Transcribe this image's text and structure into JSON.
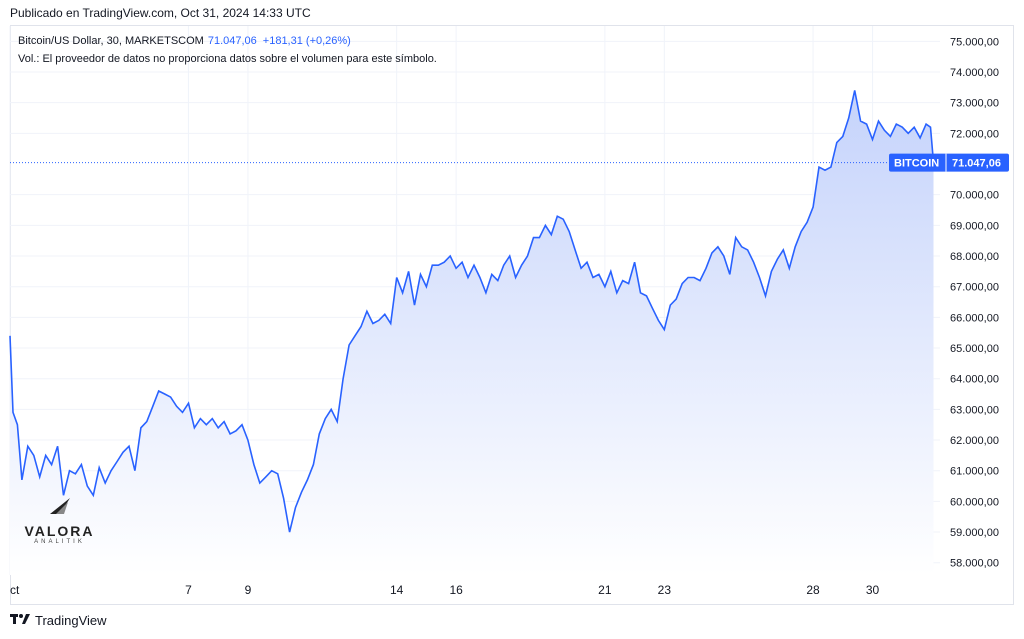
{
  "header": {
    "publish_line": "Publicado en TradingView.com, Oct 31, 2024 14:33 UTC"
  },
  "legend": {
    "symbol": "Bitcoin/US Dollar, 30, MARKETSCOM",
    "last_value": "71.047,06",
    "change": "+181,31 (+0,26%)",
    "volume_note": "Vol.: El proveedor de datos no proporciona datos sobre el volumen para este símbolo."
  },
  "price_tag": {
    "label": "BITCOIN",
    "value": "71.047,06"
  },
  "watermark": {
    "brand": "VALORA",
    "sub": "ANALITIK"
  },
  "footer": {
    "brand": "TradingView"
  },
  "colors": {
    "line": "#2962ff",
    "fill_top": "#c5d3fb",
    "fill_bottom": "#ffffff",
    "grid": "#f0f3fa",
    "tag_bg": "#2962ff"
  },
  "chart_data": {
    "type": "area",
    "title": "Bitcoin/US Dollar, 30, MARKETSCOM",
    "ylim": [
      57600,
      75500
    ],
    "y_ticks": [
      {
        "value": 58000,
        "label": "58.000,00"
      },
      {
        "value": 59000,
        "label": "59.000,00"
      },
      {
        "value": 60000,
        "label": "60.000,00"
      },
      {
        "value": 61000,
        "label": "61.000,00"
      },
      {
        "value": 62000,
        "label": "62.000,00"
      },
      {
        "value": 63000,
        "label": "63.000,00"
      },
      {
        "value": 64000,
        "label": "64.000,00"
      },
      {
        "value": 65000,
        "label": "65.000,00"
      },
      {
        "value": 66000,
        "label": "66.000,00"
      },
      {
        "value": 67000,
        "label": "67.000,00"
      },
      {
        "value": 68000,
        "label": "68.000,00"
      },
      {
        "value": 69000,
        "label": "69.000,00"
      },
      {
        "value": 70000,
        "label": "70.000,00"
      },
      {
        "value": 72000,
        "label": "72.000,00"
      },
      {
        "value": 73000,
        "label": "73.000,00"
      },
      {
        "value": 74000,
        "label": "74.000,00"
      },
      {
        "value": 75000,
        "label": "75.000,00"
      }
    ],
    "xlim": [
      1,
      32.1
    ],
    "x_ticks": [
      {
        "value": 1,
        "label": "ct"
      },
      {
        "value": 7,
        "label": "7"
      },
      {
        "value": 9,
        "label": "9"
      },
      {
        "value": 14,
        "label": "14"
      },
      {
        "value": 16,
        "label": "16"
      },
      {
        "value": 21,
        "label": "21"
      },
      {
        "value": 23,
        "label": "23"
      },
      {
        "value": 28,
        "label": "28"
      },
      {
        "value": 30,
        "label": "30"
      }
    ],
    "last_price": 71047.06,
    "series": [
      {
        "x": [
          1.0,
          1.1,
          1.25,
          1.4,
          1.6,
          1.8,
          2.0,
          2.2,
          2.4,
          2.6,
          2.8,
          3.0,
          3.2,
          3.4,
          3.6,
          3.8,
          4.0,
          4.2,
          4.4,
          4.6,
          4.8,
          5.0,
          5.2,
          5.4,
          5.6,
          5.8,
          6.0,
          6.2,
          6.4,
          6.6,
          6.8,
          7.0,
          7.2,
          7.4,
          7.6,
          7.8,
          8.0,
          8.2,
          8.4,
          8.6,
          8.8,
          9.0,
          9.2,
          9.4,
          9.6,
          9.8,
          10.0,
          10.2,
          10.4,
          10.6,
          10.8,
          11.0,
          11.2,
          11.4,
          11.6,
          11.8,
          12.0,
          12.2,
          12.4,
          12.6,
          12.8,
          13.0,
          13.2,
          13.4,
          13.6,
          13.8,
          14.0,
          14.2,
          14.4,
          14.6,
          14.8,
          15.0,
          15.2,
          15.4,
          15.6,
          15.8,
          16.0,
          16.2,
          16.4,
          16.6,
          16.8,
          17.0,
          17.2,
          17.4,
          17.6,
          17.8,
          18.0,
          18.2,
          18.4,
          18.6,
          18.8,
          19.0,
          19.2,
          19.4,
          19.6,
          19.8,
          20.0,
          20.2,
          20.4,
          20.6,
          20.8,
          21.0,
          21.2,
          21.4,
          21.6,
          21.8,
          22.0,
          22.2,
          22.4,
          22.6,
          22.8,
          23.0,
          23.2,
          23.4,
          23.6,
          23.8,
          24.0,
          24.2,
          24.4,
          24.6,
          24.8,
          25.0,
          25.2,
          25.4,
          25.6,
          25.8,
          26.0,
          26.2,
          26.4,
          26.6,
          26.8,
          27.0,
          27.2,
          27.4,
          27.6,
          27.8,
          28.0,
          28.2,
          28.4,
          28.6,
          28.8,
          29.0,
          29.2,
          29.4,
          29.6,
          29.8,
          30.0,
          30.2,
          30.4,
          30.6,
          30.8,
          31.0,
          31.2,
          31.4,
          31.6,
          31.8,
          31.95,
          32.05
        ],
        "y": [
          65400,
          62900,
          62500,
          60700,
          61800,
          61500,
          60800,
          61500,
          61200,
          61800,
          60200,
          61000,
          60900,
          61200,
          60500,
          60200,
          61100,
          60600,
          61000,
          61300,
          61600,
          61800,
          61000,
          62400,
          62600,
          63100,
          63600,
          63500,
          63400,
          63100,
          62900,
          63200,
          62400,
          62700,
          62500,
          62700,
          62400,
          62600,
          62200,
          62300,
          62500,
          62000,
          61200,
          60600,
          60800,
          61000,
          60900,
          60100,
          59000,
          59800,
          60300,
          60700,
          61200,
          62200,
          62700,
          63000,
          62600,
          64000,
          65100,
          65400,
          65700,
          66200,
          65800,
          65900,
          66100,
          65800,
          67300,
          66800,
          67500,
          66400,
          67400,
          67000,
          67700,
          67700,
          67800,
          68000,
          67600,
          67800,
          67300,
          67700,
          67300,
          66800,
          67400,
          67200,
          67700,
          68000,
          67300,
          67700,
          68000,
          68600,
          68600,
          69000,
          68700,
          69300,
          69200,
          68800,
          68200,
          67600,
          67800,
          67300,
          67400,
          67000,
          67500,
          66800,
          67200,
          67100,
          67800,
          66800,
          66700,
          66300,
          65900,
          65600,
          66400,
          66600,
          67100,
          67300,
          67300,
          67200,
          67600,
          68100,
          68300,
          68000,
          67400,
          68600,
          68300,
          68200,
          67800,
          67300,
          66700,
          67500,
          67900,
          68200,
          67600,
          68300,
          68800,
          69100,
          69600,
          70900,
          70800,
          70900,
          71700,
          71900,
          72500,
          73400,
          72400,
          72300,
          71800,
          72400,
          72100,
          71900,
          72300,
          72200,
          72000,
          72200,
          71850,
          72300,
          72200,
          71047
        ]
      }
    ]
  }
}
